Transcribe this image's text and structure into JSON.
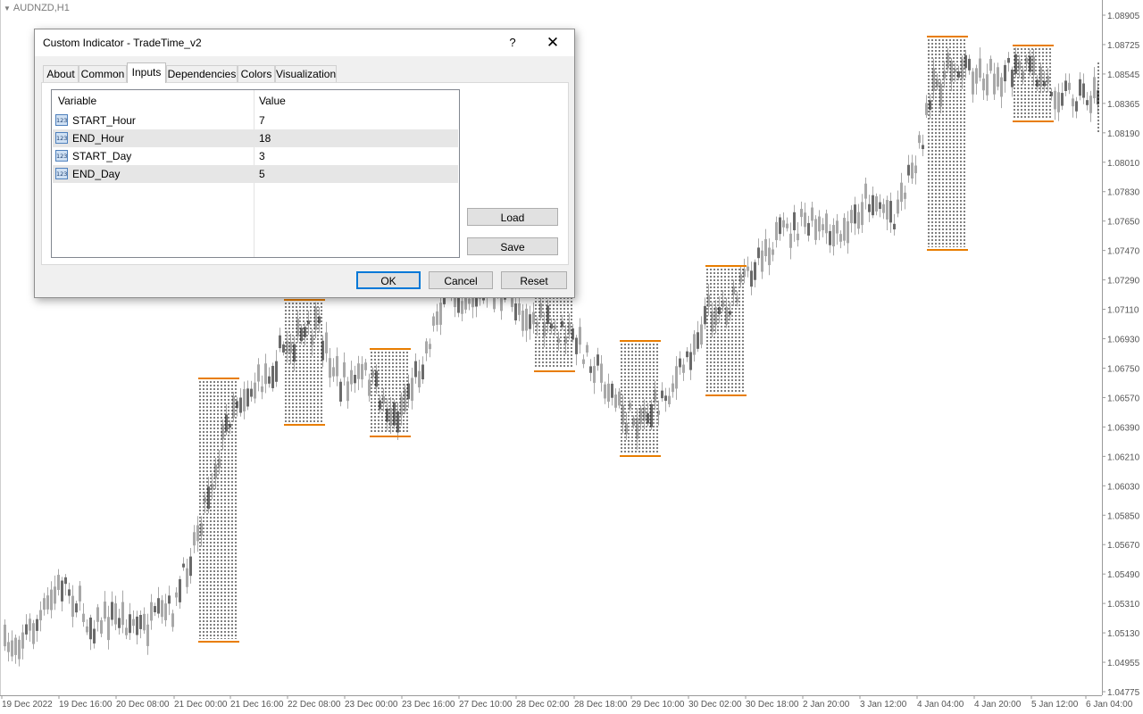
{
  "chart": {
    "symbol": "AUDNZD,H1",
    "price_labels": [
      "1.08905",
      "1.08725",
      "1.08545",
      "1.08365",
      "1.08190",
      "1.08010",
      "1.07830",
      "1.07650",
      "1.07470",
      "1.07290",
      "1.07110",
      "1.06930",
      "1.06750",
      "1.06570",
      "1.06390",
      "1.06210",
      "1.06030",
      "1.05850",
      "1.05670",
      "1.05490",
      "1.05310",
      "1.05130",
      "1.04955",
      "1.04775"
    ],
    "time_labels": [
      "19 Dec 2022",
      "19 Dec 16:00",
      "20 Dec 08:00",
      "21 Dec 00:00",
      "21 Dec 16:00",
      "22 Dec 08:00",
      "23 Dec 00:00",
      "23 Dec 16:00",
      "27 Dec 10:00",
      "28 Dec 02:00",
      "28 Dec 18:00",
      "29 Dec 10:00",
      "30 Dec 02:00",
      "30 Dec 18:00",
      "2 Jan 20:00",
      "3 Jan 12:00",
      "4 Jan 04:00",
      "4 Jan 20:00",
      "5 Jan 12:00",
      "6 Jan 04:00"
    ],
    "colors": {
      "candle": "#a8a8a8",
      "candle_dark": "#6a6a6a",
      "session_line": "#e87d00",
      "dots": "#000000",
      "axis": "#9a9a9a"
    }
  },
  "dialog": {
    "title": "Custom Indicator - TradeTime_v2",
    "help_label": "?",
    "close_label": "✕",
    "tabs": [
      "About",
      "Common",
      "Inputs",
      "Dependencies",
      "Colors",
      "Visualization"
    ],
    "active_tab": "Inputs",
    "table": {
      "headers": [
        "Variable",
        "Value"
      ],
      "rows": [
        {
          "icon": "123",
          "variable": "START_Hour",
          "value": "7"
        },
        {
          "icon": "123",
          "variable": "END_Hour",
          "value": "18"
        },
        {
          "icon": "123",
          "variable": "START_Day",
          "value": "3"
        },
        {
          "icon": "123",
          "variable": "END_Day",
          "value": "5"
        }
      ]
    },
    "load_label": "Load",
    "save_label": "Save",
    "ok_label": "OK",
    "cancel_label": "Cancel",
    "reset_label": "Reset"
  }
}
